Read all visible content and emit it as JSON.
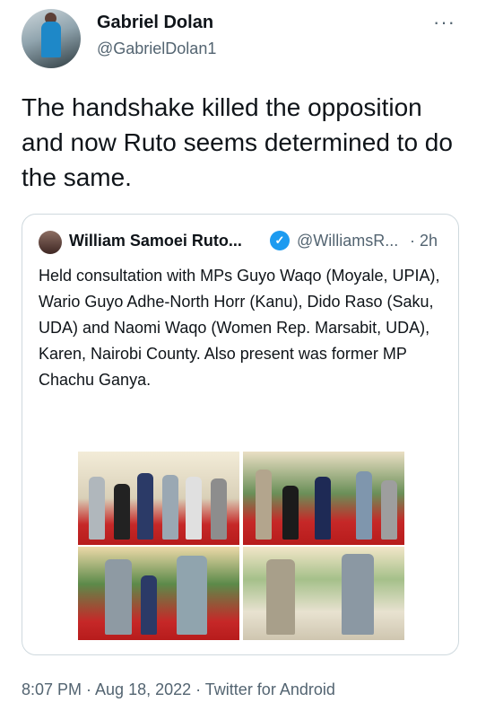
{
  "tweet": {
    "author_name": "Gabriel Dolan",
    "author_handle": "@GabrielDolan1",
    "more_icon": "ellipsis-icon",
    "text": "The handshake killed the opposition and now Ruto seems determined to do the same.",
    "meta": "8:07 PM · Aug 18, 2022 · Twitter for Android"
  },
  "quote": {
    "author_name": "William Samoei Ruto...",
    "verified_icon": "verified-badge-icon",
    "author_handle": "@WilliamsR...",
    "time": "· 2h",
    "text": "Held consultation with MPs Guyo Waqo (Moyale, UPIA), Wario Guyo Adhe-North Horr (Kanu), Dido Raso (Saku, UDA) and Naomi Waqo (Women Rep. Marsabit, UDA), Karen, Nairobi County. Also present was former MP Chachu Ganya."
  },
  "colors": {
    "text_primary": "#0f1419",
    "text_secondary": "#536471",
    "border": "#cfd9de",
    "verified": "#1d9bf0"
  }
}
